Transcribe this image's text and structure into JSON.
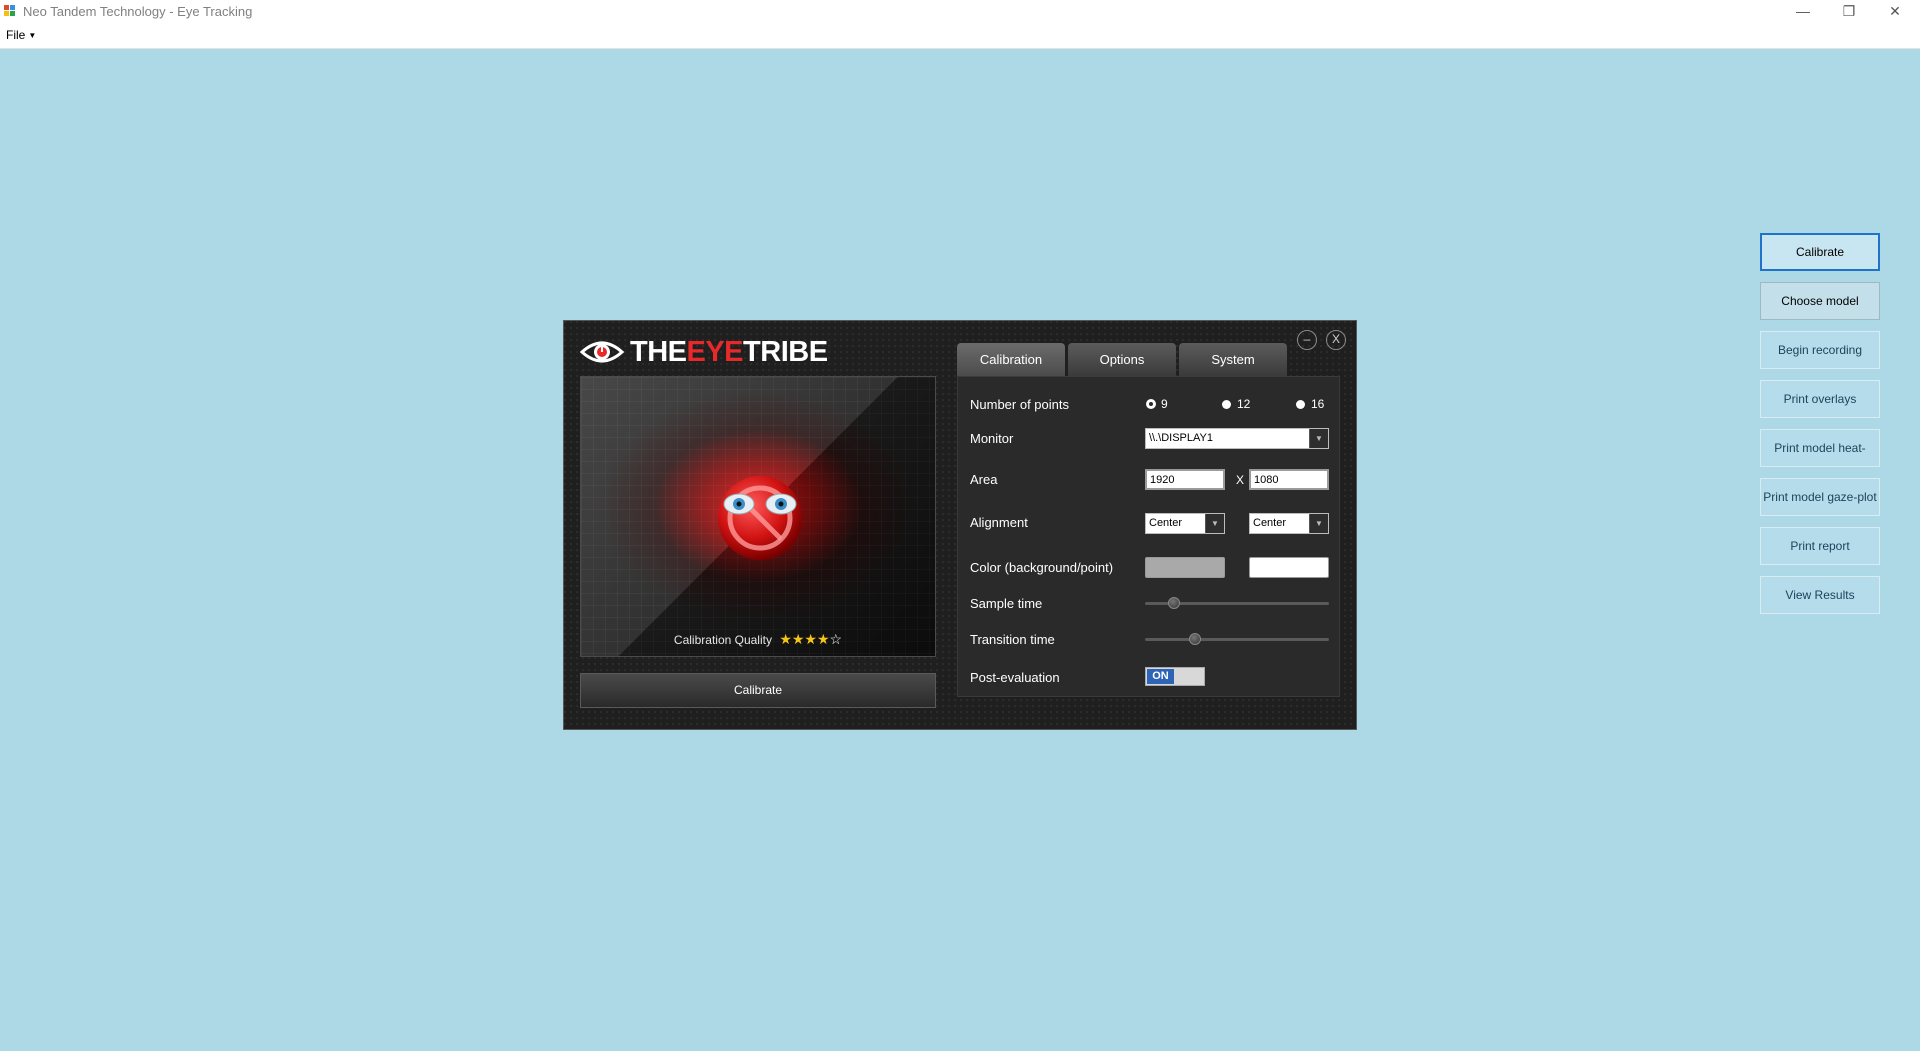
{
  "window": {
    "title": "Neo Tandem Technology - Eye Tracking",
    "minimize": "—",
    "maximize": "❐",
    "close": "✕"
  },
  "menu": {
    "file": "File"
  },
  "dialog": {
    "logo_prefix": "THE",
    "logo_highlight": "EYE",
    "logo_suffix": "TRIBE",
    "minimize": "–",
    "close": "X",
    "calibration_quality_label": "Calibration Quality",
    "calibration_quality_stars": 4,
    "calibration_quality_max": 5,
    "stars_filled": "★★★★",
    "stars_empty": "☆",
    "calibrate_button": "Calibrate",
    "tabs": [
      "Calibration",
      "Options",
      "System"
    ],
    "active_tab": "Calibration",
    "settings": {
      "number_of_points_label": "Number of points",
      "points_options": [
        "9",
        "12",
        "16"
      ],
      "points_selected": "9",
      "monitor_label": "Monitor",
      "monitor_value": "\\\\.\\DISPLAY1",
      "area_label": "Area",
      "area_width": "1920",
      "area_x": "X",
      "area_height": "1080",
      "alignment_label": "Alignment",
      "alignment_horizontal": "Center",
      "alignment_vertical": "Center",
      "color_label": "Color (background/point)",
      "background_color": "#a9a9a9",
      "point_color": "#ffffff",
      "sample_time_label": "Sample time",
      "sample_time_fraction": 0.16,
      "transition_time_label": "Transition time",
      "transition_time_fraction": 0.27,
      "post_evaluation_label": "Post-evaluation",
      "post_evaluation_value": "ON"
    }
  },
  "sidebar": {
    "buttons": [
      "Calibrate",
      "Choose model",
      "Begin recording",
      "Print overlays",
      "Print model heat-maps",
      "Print model gaze-plot",
      "Print report",
      "View Results"
    ]
  },
  "colors": {
    "desktop": "#add8e6",
    "accent_red": "#e8292a",
    "toggle_on": "#2d64b8"
  }
}
